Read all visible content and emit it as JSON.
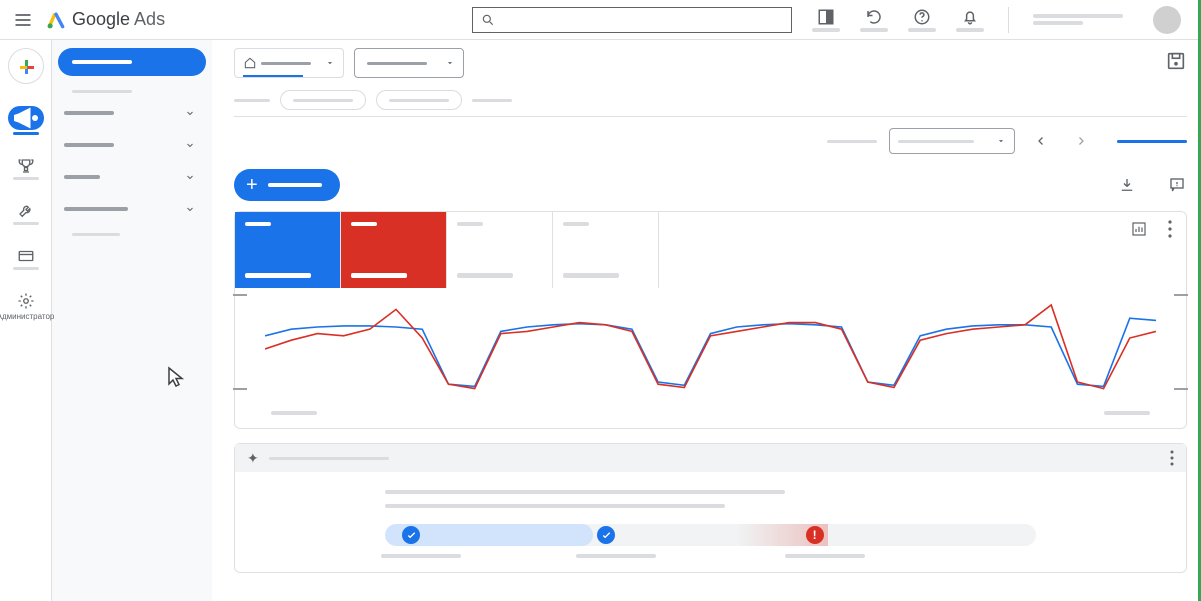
{
  "header": {
    "product_name": "Google Ads",
    "search_placeholder": "",
    "icons": [
      "appearance",
      "refresh",
      "help",
      "notifications"
    ]
  },
  "left_rail": {
    "items": [
      {
        "name": "create",
        "label": ""
      },
      {
        "name": "campaigns",
        "label": "",
        "active": true
      },
      {
        "name": "goals",
        "label": ""
      },
      {
        "name": "tools",
        "label": ""
      },
      {
        "name": "billing",
        "label": ""
      },
      {
        "name": "admin",
        "label": "Администратор"
      }
    ]
  },
  "sidebar": {
    "primary_label": "",
    "sub_label": "",
    "sections": [
      {
        "label": ""
      },
      {
        "label": ""
      },
      {
        "label": ""
      },
      {
        "label": ""
      }
    ],
    "footer_label": ""
  },
  "filters": {
    "selector1": "",
    "selector2": ""
  },
  "breadcrumbs": [
    "",
    "",
    "",
    ""
  ],
  "date_range": {
    "label": "",
    "value": "",
    "compare": ""
  },
  "new_button_label": "",
  "metric_tabs": [
    {
      "title": "",
      "value": "",
      "color": "blue"
    },
    {
      "title": "",
      "value": "",
      "color": "red"
    },
    {
      "title": "",
      "value": "",
      "color": "plain"
    },
    {
      "title": "",
      "value": "",
      "color": "plain"
    }
  ],
  "chart_data": {
    "type": "line",
    "x": [
      0,
      1,
      2,
      3,
      4,
      5,
      6,
      7,
      8,
      9,
      10,
      11,
      12,
      13,
      14,
      15,
      16,
      17,
      18,
      19,
      20,
      21,
      22,
      23,
      24,
      25,
      26,
      27,
      28,
      29,
      30,
      31,
      32,
      33,
      34
    ],
    "series": [
      {
        "name": "metric_blue",
        "color": "#1a73e8",
        "values": [
          62,
          68,
          70,
          71,
          71,
          70,
          68,
          18,
          16,
          66,
          70,
          72,
          73,
          72,
          68,
          20,
          17,
          64,
          70,
          72,
          73,
          72,
          70,
          20,
          17,
          62,
          68,
          71,
          72,
          72,
          70,
          18,
          16,
          78,
          76
        ]
      },
      {
        "name": "metric_red",
        "color": "#d93025",
        "values": [
          50,
          58,
          64,
          62,
          68,
          86,
          60,
          18,
          14,
          64,
          66,
          70,
          74,
          72,
          66,
          18,
          15,
          62,
          66,
          70,
          74,
          74,
          68,
          20,
          15,
          58,
          64,
          68,
          70,
          72,
          90,
          20,
          14,
          60,
          66
        ]
      }
    ],
    "ylim": [
      0,
      100
    ],
    "xlabel": "",
    "ylabel": "",
    "x_tick_labels": [
      "",
      ""
    ]
  },
  "score": {
    "header": "",
    "line1": "",
    "line2": "",
    "progress_pct": 32,
    "checkpoints": [
      {
        "pct": 4,
        "state": "done"
      },
      {
        "pct": 34,
        "state": "done"
      },
      {
        "pct": 66,
        "state": "warn"
      }
    ],
    "labels": [
      "",
      "",
      ""
    ]
  }
}
